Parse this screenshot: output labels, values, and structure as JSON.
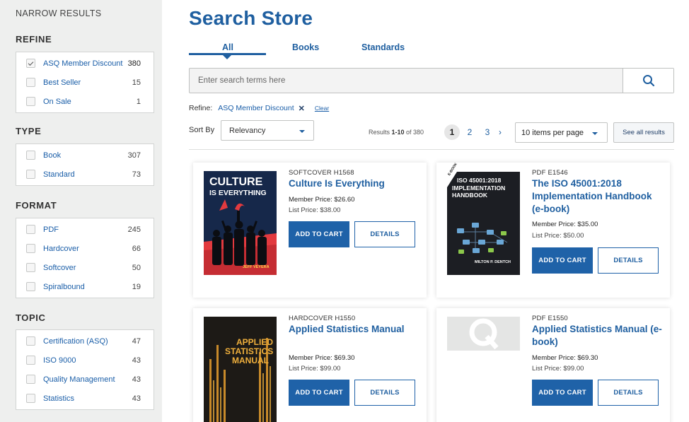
{
  "sidebar": {
    "narrow_title": "NARROW RESULTS",
    "sections": [
      {
        "title": "REFINE",
        "items": [
          {
            "label": "ASQ Member Discount",
            "count": "380",
            "checked": true
          },
          {
            "label": "Best Seller",
            "count": "15",
            "checked": false
          },
          {
            "label": "On Sale",
            "count": "1",
            "checked": false
          }
        ]
      },
      {
        "title": "TYPE",
        "items": [
          {
            "label": "Book",
            "count": "307",
            "checked": false
          },
          {
            "label": "Standard",
            "count": "73",
            "checked": false
          }
        ]
      },
      {
        "title": "FORMAT",
        "items": [
          {
            "label": "PDF",
            "count": "245",
            "checked": false
          },
          {
            "label": "Hardcover",
            "count": "66",
            "checked": false
          },
          {
            "label": "Softcover",
            "count": "50",
            "checked": false
          },
          {
            "label": "Spiralbound",
            "count": "19",
            "checked": false
          }
        ]
      },
      {
        "title": "TOPIC",
        "items": [
          {
            "label": "Certification (ASQ)",
            "count": "47",
            "checked": false
          },
          {
            "label": "ISO 9000",
            "count": "43",
            "checked": false
          },
          {
            "label": "Quality Management",
            "count": "43",
            "checked": false
          },
          {
            "label": "Statistics",
            "count": "43",
            "checked": false
          }
        ]
      }
    ]
  },
  "main": {
    "title": "Search Store",
    "tabs": [
      {
        "label": "All",
        "active": true
      },
      {
        "label": "Books",
        "active": false
      },
      {
        "label": "Standards",
        "active": false
      }
    ],
    "search": {
      "placeholder": "Enter search terms here",
      "value": ""
    },
    "refine": {
      "label": "Refine:",
      "chip": "ASQ Member Discount",
      "clear": "Clear"
    },
    "sort": {
      "label": "Sort By",
      "value": "Relevancy"
    },
    "results": {
      "prefix": "Results ",
      "range": "1-10",
      "of": " of ",
      "total": "380"
    },
    "pages": [
      "1",
      "2",
      "3"
    ],
    "current_page": "1",
    "next_glyph": "›",
    "per_page": "10 items per page",
    "see_all": "See all results"
  },
  "products": [
    {
      "format": "SOFTCOVER H1568",
      "title": "Culture Is Everything",
      "member_price": "Member Price: $26.60",
      "list_price": "List Price: $38.00",
      "add_label": "ADD TO CART",
      "details_label": "DETAILS",
      "cover": {
        "line1": "CULTURE",
        "line2": "IS EVERYTHING",
        "author": "JEFF VEYERA"
      }
    },
    {
      "format": "PDF E1546",
      "title": "The ISO 45001:2018 Implementation Handbook (e-book)",
      "member_price": "Member Price: $35.00",
      "list_price": "List Price: $50.00",
      "add_label": "ADD TO CART",
      "details_label": "DETAILS",
      "cover": {
        "badge": "E-BOOK",
        "line1": "ISO 45001:2018",
        "line2": "IMPLEMENTATION",
        "line3": "HANDBOOK",
        "author": "MILTON P. DENTCH"
      }
    },
    {
      "format": "HARDCOVER H1550",
      "title": "Applied Statistics Manual",
      "member_price": "Member Price: $69.30",
      "list_price": "List Price: $99.00",
      "add_label": "ADD TO CART",
      "details_label": "DETAILS",
      "cover": {
        "line1": "APPLIED",
        "line2": "STATISTICS",
        "line3": "MANUAL"
      }
    },
    {
      "format": "PDF E1550",
      "title": "Applied Statistics Manual (e-book)",
      "member_price": "Member Price: $69.30",
      "list_price": "List Price: $99.00",
      "add_label": "ADD TO CART",
      "details_label": "DETAILS",
      "cover": {}
    }
  ],
  "colors": {
    "brand_blue": "#1f5fa0",
    "button_blue": "#1f62a8",
    "sidebar_bg": "#eeefee"
  }
}
